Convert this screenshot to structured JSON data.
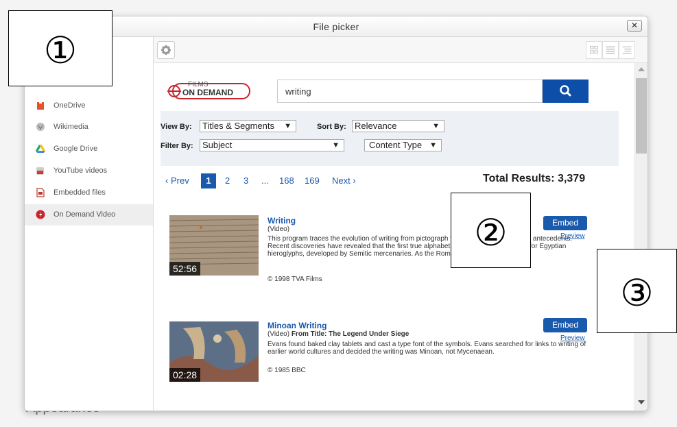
{
  "background": {
    "label": "Appearance"
  },
  "dialog": {
    "title": "File picker",
    "close_icon": "close-icon"
  },
  "sidebar": {
    "items": [
      {
        "label": "OneDrive",
        "icon": "onedrive-icon",
        "color": "#e5532a"
      },
      {
        "label": "Wikimedia",
        "icon": "wikimedia-icon",
        "color": "#999999"
      },
      {
        "label": "Google Drive",
        "icon": "google-drive-icon",
        "color": "#2c9b47"
      },
      {
        "label": "YouTube videos",
        "icon": "youtube-icon",
        "color": "#d53a2d"
      },
      {
        "label": "Embedded files",
        "icon": "embedded-file-icon",
        "color": "#c03a2b"
      },
      {
        "label": "On Demand Video",
        "icon": "on-demand-video-icon",
        "color": "#c8242b",
        "active": true
      }
    ]
  },
  "toolbar": {
    "settings_icon": "gear-icon",
    "views": [
      "grid-view-icon",
      "list-view-icon",
      "tree-view-icon"
    ]
  },
  "search": {
    "logo_top": "FILMS",
    "logo_bottom": "ON DEMAND",
    "value": "writing",
    "button_icon": "search-icon"
  },
  "filters": {
    "view_by_label": "View By:",
    "view_by_value": "Titles & Segments",
    "sort_by_label": "Sort By:",
    "sort_by_value": "Relevance",
    "filter_by_label": "Filter By:",
    "filter_by_value": "Subject",
    "content_type_value": "Content Type",
    "arrow": "▼"
  },
  "pagination": {
    "prev": "Prev",
    "prev_arrow": "‹",
    "current": "1",
    "pages": [
      "2",
      "3",
      "...",
      "168",
      "169"
    ],
    "next": "Next",
    "next_arrow": "›",
    "total": "Total Results: 3,379"
  },
  "results": [
    {
      "title": "Writing",
      "subtitle_type": "(Video)",
      "subtitle_from": "",
      "description": "This program traces the evolution of writing from pictograph to alphabet and hieroglyph antecedents. Recent discoveries have revealed that the first true alphabet was corrupted shorthand for Egyptian hieroglyphs, developed by Semitic mercenaries. As the Roman ...",
      "copyright": "© 1998 TVA Films",
      "duration": "52:56",
      "embed_label": "Embed",
      "preview_label": "Preview"
    },
    {
      "title": "Minoan Writing",
      "subtitle_type": "(Video)",
      "subtitle_from": "From Title: The Legend Under Siege",
      "description": "Evans found baked clay tablets and cast a type font of the symbols. Evans searched for links to writing of earlier world cultures and decided the writing was Minoan, not Mycenaean.",
      "copyright": "© 1985 BBC",
      "duration": "02:28",
      "embed_label": "Embed",
      "preview_label": "Preview"
    }
  ],
  "annotations": [
    {
      "label": "①"
    },
    {
      "label": "②"
    },
    {
      "label": "③"
    }
  ]
}
